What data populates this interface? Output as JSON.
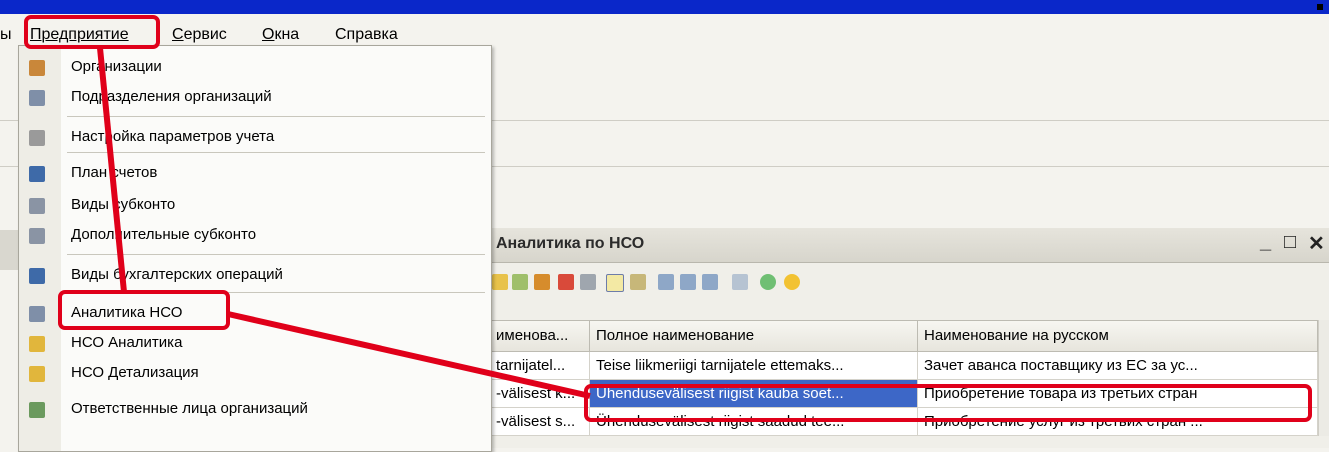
{
  "menubar": {
    "prefix": "ы",
    "items": [
      {
        "label": "Предприятие",
        "u": "П",
        "rest": "редприятие"
      },
      {
        "label": "Сервис",
        "u": "С",
        "rest": "ервис"
      },
      {
        "label": "Окна",
        "u": "О",
        "rest": "кна"
      },
      {
        "label": "Справка",
        "u": "",
        "rest": "Справка"
      }
    ]
  },
  "dropdown": {
    "items": [
      {
        "label": "Организации",
        "icon": "organization-icon"
      },
      {
        "label": "Подразделения организаций",
        "icon": "table-icon"
      },
      {
        "label": "Настройка параметров учета",
        "icon": "gear-icon"
      },
      {
        "label": "План счетов",
        "icon": "chart-of-accounts-icon"
      },
      {
        "label": "Виды субконто",
        "icon": "list-icon"
      },
      {
        "label": "Дополнительные субконто",
        "icon": "list-icon"
      },
      {
        "label": "Виды бухгалтерских операций",
        "icon": "operations-icon"
      },
      {
        "label": "Аналитика НСО",
        "icon": "table-icon"
      },
      {
        "label": "НСО Аналитика",
        "icon": "document-icon"
      },
      {
        "label": "НСО Детализация",
        "icon": "document-icon"
      },
      {
        "label": "Ответственные лица организаций",
        "icon": "grid-icon"
      }
    ]
  },
  "window": {
    "title": "Аналитика по НСО",
    "minimize": "_",
    "maximize": "□",
    "close": "✕"
  },
  "table": {
    "columns": [
      "именова...",
      "Полное наименование",
      "Наименование на русском"
    ],
    "rows": [
      [
        "tarnijatel...",
        "Teise liikmeriigi tarnijatele ettemaks...",
        "Зачет аванса поставщику из ЕС за ус..."
      ],
      [
        "-välisest k...",
        "Ühendusevälisest riigist kauba soet...",
        "Приобретение товара из третьих стран"
      ],
      [
        "-välisest s...",
        "Ühendusevälisest riigist saadud tee...",
        "Приобретение услуг из третьих стран ..."
      ]
    ],
    "selected_row": 1,
    "selected_col": 1
  },
  "colors": {
    "annotation": "#e0001a",
    "selection": "#3d67c7",
    "titlebar": "#0a27c9"
  }
}
